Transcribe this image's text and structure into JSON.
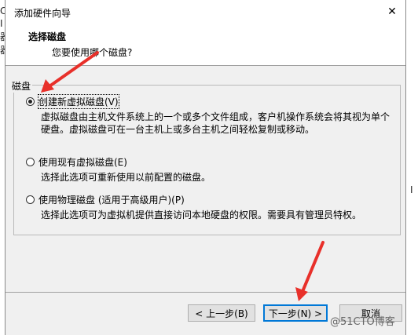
{
  "background": {
    "left_chars": [
      "C",
      "I",
      "器",
      "器"
    ],
    "right_char": "I"
  },
  "window": {
    "title": "添加硬件向导",
    "close_glyph": "✕"
  },
  "header": {
    "title": "选择磁盘",
    "subtitle": "您要使用哪个磁盘?"
  },
  "group": {
    "label": "磁盘",
    "options": [
      {
        "label": "创建新虚拟磁盘(V)",
        "checked": true,
        "description": [
          "虚拟磁盘由主机文件系统上的一个或多个文件组成，客户机操作系统会将其视为单个",
          "硬盘。虚拟磁盘可在一台主机上或多台主机之间轻松复制或移动。"
        ]
      },
      {
        "label": "使用现有虚拟磁盘(E)",
        "checked": false,
        "description": [
          "选择此选项可重新使用以前配置的磁盘。"
        ]
      },
      {
        "label": "使用物理磁盘 (适用于高级用户)(P)",
        "checked": false,
        "description": [
          "选择此选项可为虚拟机提供直接访问本地硬盘的权限。需要具有管理员特权。"
        ]
      }
    ]
  },
  "buttons": {
    "back": "< 上一步(B)",
    "next": "下一步(N) >",
    "cancel": "取消"
  },
  "watermark": "@51CTO博客",
  "colors": {
    "annotation_arrow": "#e8302a",
    "dialog_bg": "#f0f0f0",
    "accent": "#0078d7"
  }
}
